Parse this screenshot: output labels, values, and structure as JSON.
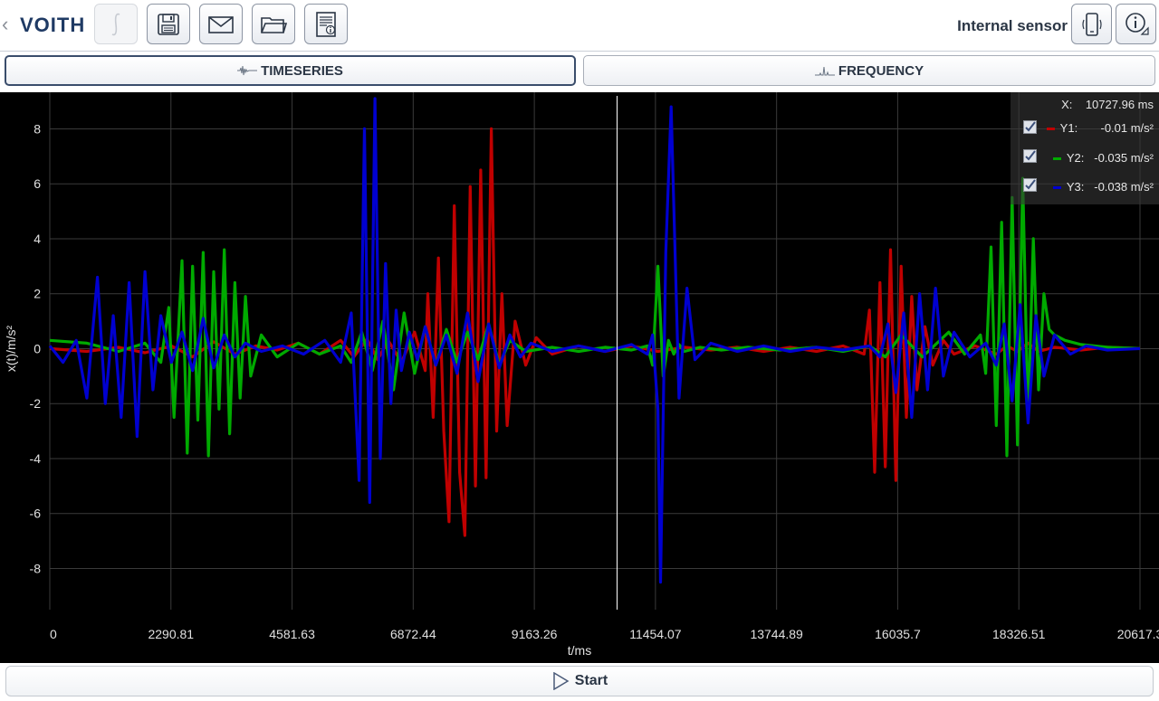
{
  "toolbar": {
    "brand": "VOITH",
    "sensor_label": "Internal sensor",
    "buttons": [
      "integral-button",
      "save-button",
      "email-button",
      "open-folder-button",
      "report-button",
      "sensor-device-button",
      "info-button"
    ]
  },
  "tabs": [
    {
      "label": "TIMESERIES",
      "active": true
    },
    {
      "label": "FREQUENCY",
      "active": false
    }
  ],
  "cursor": {
    "x_label": "X:",
    "x_value": "10727.96 ms",
    "rows": [
      {
        "label": "Y1:",
        "value": "-0.01 m/s²",
        "color": "#c00000",
        "checked": true
      },
      {
        "label": "Y2:",
        "value": "-0.035 m/s²",
        "color": "#00aa00",
        "checked": true
      },
      {
        "label": "Y3:",
        "value": "-0.038 m/s²",
        "color": "#0000d0",
        "checked": true
      }
    ]
  },
  "nav": {
    "prev": "<",
    "next": ">"
  },
  "start_label": "Start",
  "chart_data": {
    "type": "line",
    "xlabel": "t/ms",
    "ylabel": "x(t)/m/s²",
    "xlim": [
      0,
      20617.3
    ],
    "ylim": [
      -9.5,
      9.2
    ],
    "x_ticks": [
      "0",
      "2290.81",
      "4581.63",
      "6872.44",
      "9163.26",
      "11454.07",
      "13744.89",
      "16035.7",
      "18326.51",
      "20617.3"
    ],
    "y_ticks": [
      -8,
      -6,
      -4,
      -2,
      0,
      2,
      4,
      6,
      8
    ],
    "grid": true,
    "cursor_x": 10727.96,
    "series": [
      {
        "name": "Y1",
        "color": "#c00000",
        "x": [
          0,
          700,
          1300,
          1800,
          2300,
          2700,
          3100,
          3500,
          3900,
          4300,
          4700,
          5100,
          5500,
          5750,
          6000,
          6200,
          6400,
          6650,
          6900,
          7100,
          7150,
          7250,
          7350,
          7450,
          7550,
          7650,
          7750,
          7850,
          7950,
          8050,
          8150,
          8250,
          8350,
          8450,
          8550,
          8650,
          8800,
          9000,
          9200,
          9500,
          10000,
          10500,
          11000,
          11500,
          12000,
          12500,
          13000,
          13500,
          14000,
          14500,
          15000,
          15400,
          15500,
          15600,
          15700,
          15800,
          15900,
          16000,
          16100,
          16200,
          16300,
          16400,
          16550,
          16700,
          16900,
          17100,
          17500,
          17900,
          18100,
          18300,
          18500,
          18700,
          19000,
          19500,
          20000,
          20617
        ],
        "y": [
          0,
          -0.1,
          0.05,
          -0.15,
          0.1,
          -0.3,
          0.25,
          -0.2,
          0.1,
          -0.05,
          0.2,
          -0.2,
          0.3,
          -0.3,
          0.35,
          -0.4,
          0.3,
          -0.5,
          0.6,
          -0.8,
          2.0,
          -2.5,
          3.3,
          -3.0,
          -6.3,
          5.2,
          -4.5,
          -6.8,
          5.9,
          -5.0,
          6.5,
          -4.7,
          8.0,
          -3.0,
          2.0,
          -2.8,
          1.0,
          -0.6,
          0.4,
          -0.2,
          0.1,
          -0.1,
          0.1,
          -0.1,
          0.05,
          -0.05,
          0.05,
          -0.1,
          0.05,
          -0.1,
          0.1,
          -0.2,
          1.4,
          -4.5,
          2.4,
          -4.3,
          3.6,
          -4.8,
          3.0,
          -2.5,
          1.9,
          -1.5,
          0.8,
          -0.6,
          0.3,
          -0.2,
          0.1,
          -0.2,
          0.1,
          -0.1,
          0.2,
          -0.1,
          0.05,
          -0.05,
          0.05,
          0
        ]
      },
      {
        "name": "Y2",
        "color": "#00aa00",
        "x": [
          0,
          700,
          1300,
          1800,
          2100,
          2250,
          2350,
          2500,
          2600,
          2700,
          2800,
          2900,
          3000,
          3100,
          3200,
          3300,
          3400,
          3500,
          3600,
          3700,
          3800,
          4000,
          4300,
          4700,
          5100,
          5500,
          5700,
          5900,
          6100,
          6300,
          6500,
          6700,
          6900,
          7100,
          7300,
          7500,
          7700,
          7900,
          8100,
          8300,
          8500,
          8700,
          9000,
          9500,
          10000,
          10500,
          11000,
          11300,
          11400,
          11500,
          11600,
          11700,
          11800,
          11900,
          12000,
          12300,
          12700,
          13200,
          13800,
          14500,
          15000,
          15500,
          15800,
          16100,
          16500,
          17000,
          17300,
          17600,
          17700,
          17800,
          17900,
          18000,
          18100,
          18200,
          18300,
          18400,
          18500,
          18600,
          18700,
          18800,
          18900,
          19000,
          19200,
          19500,
          20000,
          20617
        ],
        "y": [
          0.3,
          0.2,
          -0.1,
          0.2,
          -0.5,
          1.5,
          -2.5,
          3.2,
          -3.8,
          3.0,
          -2.6,
          3.5,
          -3.9,
          2.8,
          -2.2,
          3.6,
          -3.1,
          2.4,
          -1.8,
          1.9,
          -1.0,
          0.5,
          -0.3,
          0.2,
          -0.2,
          0.1,
          -0.5,
          0.6,
          -0.8,
          1.0,
          -1.5,
          1.3,
          -0.9,
          0.8,
          -0.6,
          0.7,
          -0.5,
          0.6,
          -0.4,
          0.9,
          -0.6,
          0.3,
          -0.1,
          0.05,
          -0.1,
          0.05,
          -0.05,
          0.1,
          -0.6,
          3.0,
          -1.0,
          0.3,
          -0.2,
          0.15,
          -0.1,
          0.05,
          -0.05,
          0.05,
          -0.05,
          0.05,
          -0.1,
          0.1,
          -0.3,
          0.5,
          -0.3,
          0.6,
          -0.2,
          0.5,
          -0.9,
          3.7,
          -2.8,
          4.6,
          -3.9,
          5.5,
          -3.5,
          6.2,
          -2.6,
          4.0,
          -1.5,
          2.0,
          0.7,
          0.5,
          0.3,
          0.15,
          0.05,
          0
        ]
      },
      {
        "name": "Y3",
        "color": "#0000d0",
        "x": [
          0,
          250,
          500,
          700,
          900,
          1050,
          1200,
          1350,
          1500,
          1650,
          1800,
          1950,
          2100,
          2300,
          2500,
          2700,
          2900,
          3100,
          3300,
          3500,
          3700,
          4000,
          4400,
          4800,
          5200,
          5500,
          5700,
          5850,
          5950,
          6050,
          6150,
          6250,
          6350,
          6450,
          6550,
          6650,
          6800,
          6950,
          7100,
          7300,
          7500,
          7700,
          7900,
          8100,
          8300,
          8500,
          8700,
          8900,
          9100,
          9500,
          10000,
          10500,
          11000,
          11300,
          11400,
          11500,
          11550,
          11650,
          11750,
          11900,
          12050,
          12200,
          12500,
          13000,
          13500,
          14000,
          14500,
          15000,
          15500,
          15700,
          15850,
          16000,
          16150,
          16300,
          16450,
          16600,
          16750,
          16900,
          17100,
          17400,
          17700,
          17900,
          18050,
          18200,
          18350,
          18500,
          18650,
          18800,
          19000,
          19300,
          19600,
          20000,
          20617
        ],
        "y": [
          0.1,
          -0.5,
          0.3,
          -1.8,
          2.6,
          -2.0,
          1.2,
          -2.5,
          2.4,
          -3.2,
          2.8,
          -1.5,
          1.2,
          -0.5,
          0.6,
          -0.8,
          1.1,
          -0.7,
          0.5,
          -0.3,
          0.2,
          -0.1,
          0.1,
          -0.2,
          0.3,
          -0.5,
          1.3,
          -4.8,
          8.0,
          -5.6,
          9.1,
          -4.0,
          3.1,
          -2.0,
          1.4,
          -0.8,
          0.6,
          -0.4,
          0.8,
          -0.6,
          0.5,
          -0.9,
          1.3,
          -1.2,
          0.9,
          -0.7,
          0.5,
          -0.3,
          0.2,
          -0.1,
          0.1,
          -0.1,
          0.15,
          -0.2,
          0.5,
          -2.2,
          -8.5,
          3.5,
          8.8,
          -1.8,
          2.2,
          -0.4,
          0.2,
          -0.1,
          0.1,
          -0.1,
          0.05,
          -0.05,
          0.1,
          -0.3,
          0.9,
          -1.6,
          1.3,
          -2.5,
          2.0,
          -1.5,
          2.2,
          -1.0,
          0.6,
          -0.3,
          0.2,
          -0.6,
          0.9,
          -1.9,
          1.6,
          -2.7,
          1.2,
          -1.0,
          0.5,
          -0.2,
          0.1,
          -0.05,
          0
        ]
      }
    ]
  }
}
